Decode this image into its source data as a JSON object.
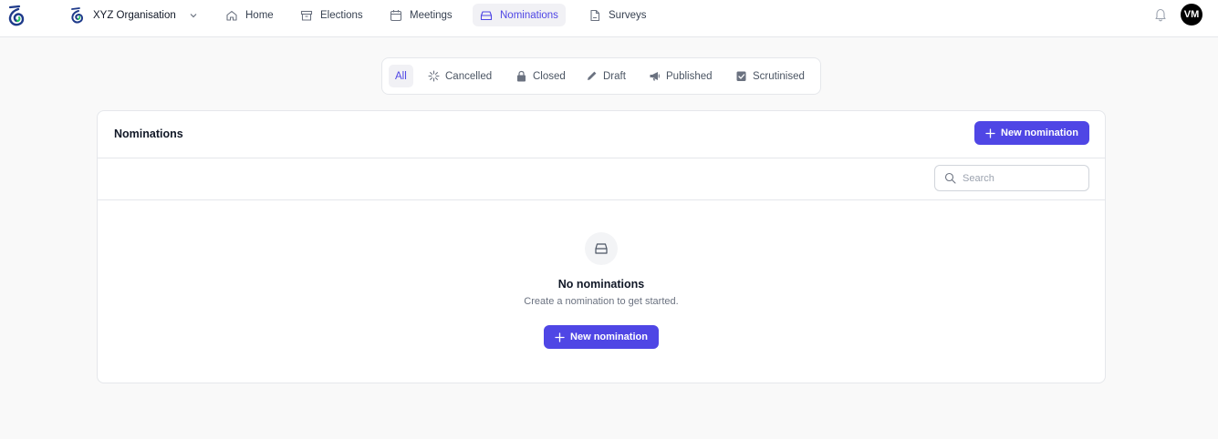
{
  "org": {
    "name": "XYZ Organisation"
  },
  "nav": {
    "home": "Home",
    "elections": "Elections",
    "meetings": "Meetings",
    "nominations": "Nominations",
    "surveys": "Surveys"
  },
  "user": {
    "initials": "VM"
  },
  "filters": {
    "all": "All",
    "cancelled": "Cancelled",
    "closed": "Closed",
    "draft": "Draft",
    "published": "Published",
    "scrutinised": "Scrutinised"
  },
  "card": {
    "title": "Nominations",
    "new_button": "New nomination",
    "search_placeholder": "Search",
    "search_value": "",
    "empty_title": "No nominations",
    "empty_subtitle": "Create a nomination to get started.",
    "empty_button": "New nomination"
  },
  "colors": {
    "accent": "#4f46e5",
    "page_bg": "#f9f9f9",
    "border": "#e5e7eb"
  },
  "icons": {
    "logo": "app-logo-icon",
    "home": "home-icon",
    "elections": "archive-box-icon",
    "meetings": "calendar-icon",
    "nominations": "inbox-icon",
    "surveys": "document-icon",
    "bell": "bell-icon",
    "cancelled": "sparkle-burst-icon",
    "closed": "lock-icon",
    "draft": "pencil-icon",
    "published": "megaphone-icon",
    "scrutinised": "check-badge-icon",
    "search": "magnifier-icon",
    "plus": "plus-icon"
  }
}
